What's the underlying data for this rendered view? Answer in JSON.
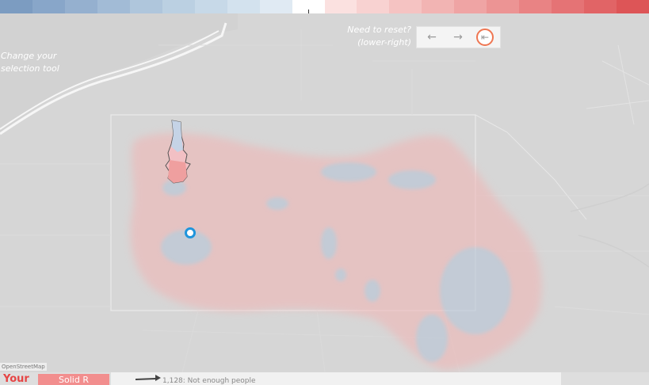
{
  "color_scale": {
    "colors": [
      "#7c9cc1",
      "#88a6c9",
      "#95b0cf",
      "#a2bbd6",
      "#afc6dc",
      "#bbd0e2",
      "#c7d9e8",
      "#d3e2ee",
      "#e0eaf3",
      "#ffffff",
      "#fbe1e0",
      "#f8d2d1",
      "#f5c3c2",
      "#f2b4b3",
      "#efa4a4",
      "#ec9494",
      "#e98384",
      "#e57375",
      "#e16466",
      "#dd5557"
    ]
  },
  "hints": {
    "selection_line1": "Change your",
    "selection_line2": "selection tool",
    "reset_line1": "Need to reset?",
    "reset_line2": "(lower-right)"
  },
  "nav": {
    "back_icon": "←",
    "forward_icon": "→",
    "reset_icon": "⇤"
  },
  "map": {
    "attribution": "OpenStreetMap",
    "district_color": "#f2b4b3",
    "marker_color": "#1f95dc"
  },
  "bottom": {
    "your_label": "Your",
    "solid_r_label": "Solid R",
    "legend_text": "1,128: Not enough people"
  }
}
